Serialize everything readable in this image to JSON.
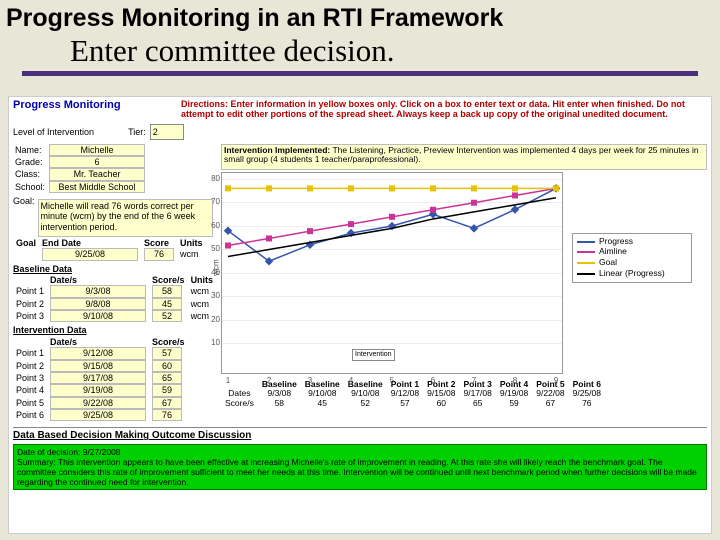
{
  "title": "Progress Monitoring in an RTI Framework",
  "subtitle": "Enter committee decision.",
  "pm_header": "Progress Monitoring",
  "directions": "Directions:  Enter information in yellow boxes only.  Click on a box to enter text or data.  Hit enter when finished.  Do not attempt to edit other portions of the spread sheet.  Always keep a back up copy of the original unedited document.",
  "level_label": "Level of Intervention",
  "tier_label": "Tier:",
  "tier_value": "2",
  "info": {
    "name_l": "Name:",
    "name": "Michelle",
    "grade_l": "Grade:",
    "grade": "6",
    "class_l": "Class:",
    "class": "Mr. Teacher",
    "school_l": "School:",
    "school": "Best Middle School"
  },
  "goal_label": "Goal:",
  "goal_text": "Michelle will read 76 words correct per minute (wcm) by the end of the 6 week intervention period.",
  "goal_hdr": {
    "c1": "Goal",
    "c2": "End Date",
    "c3": "Score",
    "c4": "Units"
  },
  "goal_row": {
    "date": "9/25/08",
    "score": "76",
    "units": "wcm"
  },
  "baseline_hdr": "Baseline Data",
  "baseline_cols": {
    "c1": "",
    "c2": "Date/s",
    "c3": "Score/s",
    "c4": "Units"
  },
  "baseline": [
    {
      "l": "Point 1",
      "d": "9/3/08",
      "s": "58",
      "u": "wcm"
    },
    {
      "l": "Point 2",
      "d": "9/8/08",
      "s": "45",
      "u": "wcm"
    },
    {
      "l": "Point 3",
      "d": "9/10/08",
      "s": "52",
      "u": "wcm"
    }
  ],
  "interv_hdr": "Intervention Data",
  "interv_cols": {
    "c1": "",
    "c2": "Date/s",
    "c3": "Score/s"
  },
  "interv": [
    {
      "l": "Point 1",
      "d": "9/12/08",
      "s": "57"
    },
    {
      "l": "Point 2",
      "d": "9/15/08",
      "s": "60"
    },
    {
      "l": "Point 3",
      "d": "9/17/08",
      "s": "65"
    },
    {
      "l": "Point 4",
      "d": "9/19/08",
      "s": "59"
    },
    {
      "l": "Point 5",
      "d": "9/22/08",
      "s": "67"
    },
    {
      "l": "Point 6",
      "d": "9/25/08",
      "s": "76"
    }
  ],
  "intervention_label": "Intervention Implemented:",
  "intervention_text": "The Listening, Practice, Preview Intervention was implemented 4 days per week for 25 minutes in small group (4 students 1 teacher/paraprofessional).",
  "legend": {
    "a": "Progress",
    "b": "Aimline",
    "c": "Goal",
    "d": "Linear (Progress)"
  },
  "ylabel": "wcm",
  "marker": "Intervention",
  "bottom_table": {
    "rows": [
      "Dates",
      "Score/s"
    ],
    "cols": [
      "Baseline",
      "Baseline",
      "Baseline",
      "Point 1",
      "Point 2",
      "Point 3",
      "Point 4",
      "Point 5",
      "Point 6"
    ],
    "dates": [
      "9/3/08",
      "9/10/08",
      "9/10/08",
      "9/12/08",
      "9/15/08",
      "9/17/08",
      "9/19/08",
      "9/22/08",
      "9/25/08"
    ],
    "scores": [
      "58",
      "45",
      "52",
      "57",
      "60",
      "65",
      "59",
      "67",
      "76"
    ]
  },
  "outcome_hdr": "Data Based Decision Making Outcome Discussion",
  "outcome_date_l": "Date of decision:",
  "outcome_date": "9/27/2008",
  "outcome_text": "Summary: This intervention appears to have been effective at increasing Michelle's rate of improvement in reading.  At this rate she will likely reach the benchmark goal.  The committee considers this rate of improvement sufficient to meet her needs at this time.  Intervention will be continued until next benchmark period when further decisions will be made regarding the continued need for intervention.",
  "chart_data": {
    "type": "line",
    "title": "",
    "xlabel": "",
    "ylabel": "wcm",
    "x": [
      1,
      2,
      3,
      4,
      5,
      6,
      7,
      8,
      9
    ],
    "ylim": [
      0,
      80
    ],
    "yticks": [
      10,
      20,
      30,
      40,
      50,
      60,
      70,
      80
    ],
    "series": [
      {
        "name": "Progress",
        "values": [
          58,
          45,
          52,
          57,
          60,
          65,
          59,
          67,
          76
        ],
        "color": "#3355aa",
        "marker": "diamond"
      },
      {
        "name": "Aimline",
        "values": [
          51.7,
          54.7,
          57.8,
          60.8,
          63.9,
          66.9,
          69.9,
          73.0,
          76.0
        ],
        "color": "#cc3399",
        "marker": "square"
      },
      {
        "name": "Goal",
        "values": [
          76,
          76,
          76,
          76,
          76,
          76,
          76,
          76,
          76
        ],
        "color": "#e6c200",
        "marker": "triangle"
      },
      {
        "name": "Linear (Progress)",
        "values": [
          47,
          50,
          53,
          56,
          59,
          63,
          66,
          69,
          72
        ],
        "color": "#000",
        "marker": "none"
      }
    ]
  }
}
